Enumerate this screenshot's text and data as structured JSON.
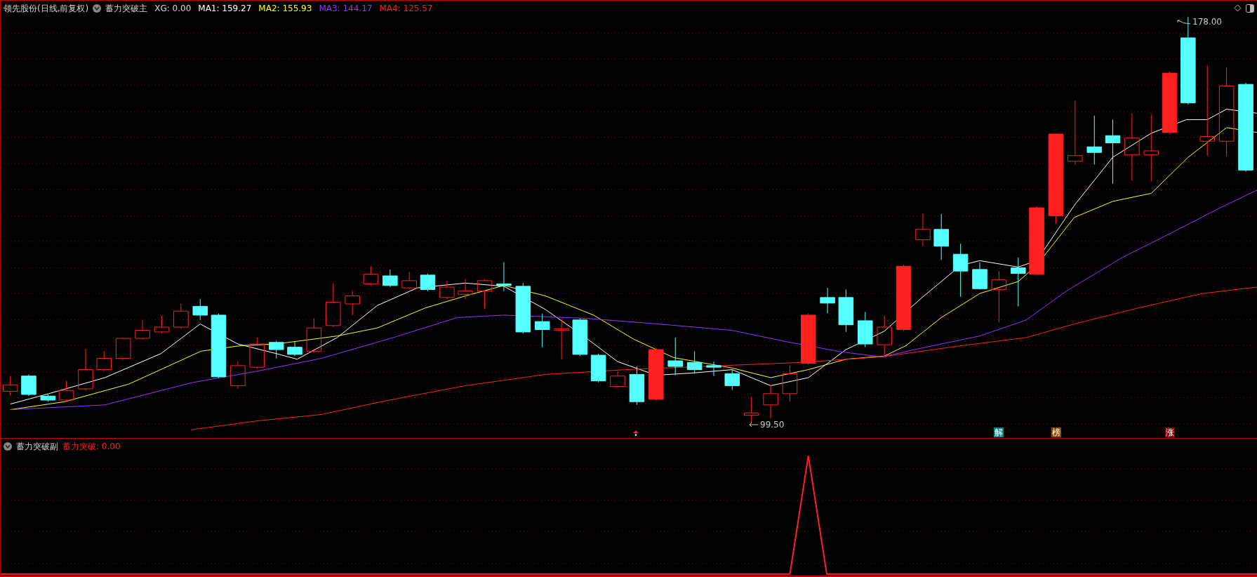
{
  "main_panel": {
    "stock_title": "领先股份(日线,前复权)",
    "indicator_name": "蓄力突破主",
    "values": [
      {
        "label": "XG: 0.00",
        "color": "#d8d8d8"
      },
      {
        "label": "MA1: 159.27",
        "color": "#ffffff"
      },
      {
        "label": "MA2: 155.93",
        "color": "#ffff00"
      },
      {
        "label": "MA3: 144.17",
        "color": "#9933ff"
      },
      {
        "label": "MA4: 125.57",
        "color": "#ff2020"
      }
    ],
    "high_label": "178.00",
    "low_label": "99.50",
    "signal_badges": [
      {
        "text": "解",
        "color": "#008b8b"
      },
      {
        "text": "榜",
        "color": "#8b4a00"
      },
      {
        "text": "涨",
        "color": "#8b0000"
      }
    ]
  },
  "sub_panel": {
    "indicator_name": "蓄力突破副",
    "value_label": "蓄力突破: 0.00"
  }
}
